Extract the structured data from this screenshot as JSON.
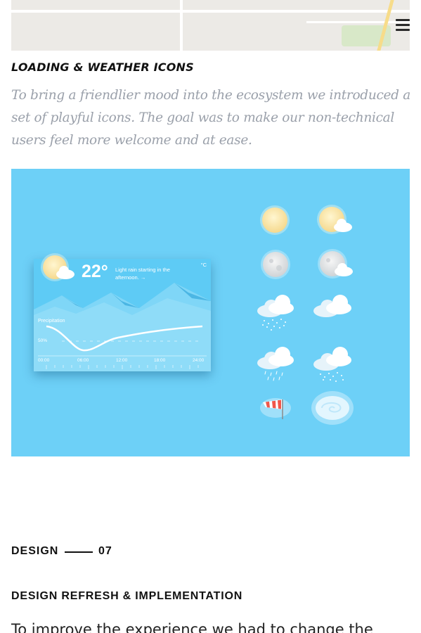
{
  "header": {
    "menu_icon": "hamburger-menu-icon"
  },
  "map": {
    "labels": [
      "",
      ""
    ]
  },
  "section": {
    "heading": "LOADING & WEATHER ICONS",
    "paragraph": "To bring a friendlier mood into the ecosystem we introduced a set of playful icons. The goal was to make our non-technical users feel more welcome and at ease."
  },
  "showcase": {
    "background_color": "#6dd0f7",
    "widget": {
      "temperature": "22°",
      "forecast": "Light rain starting in the afternoon. →",
      "unit": "°C",
      "precipitation_label": "Precipitation",
      "precipitation_percent": "50%",
      "times": [
        "00:00",
        "06:00",
        "12:00",
        "18:00",
        "24:00"
      ],
      "icon": "sun-behind-cloud-icon"
    },
    "icons": [
      "sun-icon",
      "sun-behind-cloud-icon",
      "moon-icon",
      "moon-behind-cloud-icon",
      "snow-cloud-icon",
      "cloud-icon",
      "rain-cloud-icon",
      "rain-cloud-icon-2",
      "windsock-icon",
      "fog-swirl-icon"
    ]
  },
  "design_section": {
    "label": "DESIGN",
    "number": "07",
    "heading": "DESIGN REFRESH & IMPLEMENTATION",
    "paragraph_start": "To improve the experience we had to change the"
  }
}
